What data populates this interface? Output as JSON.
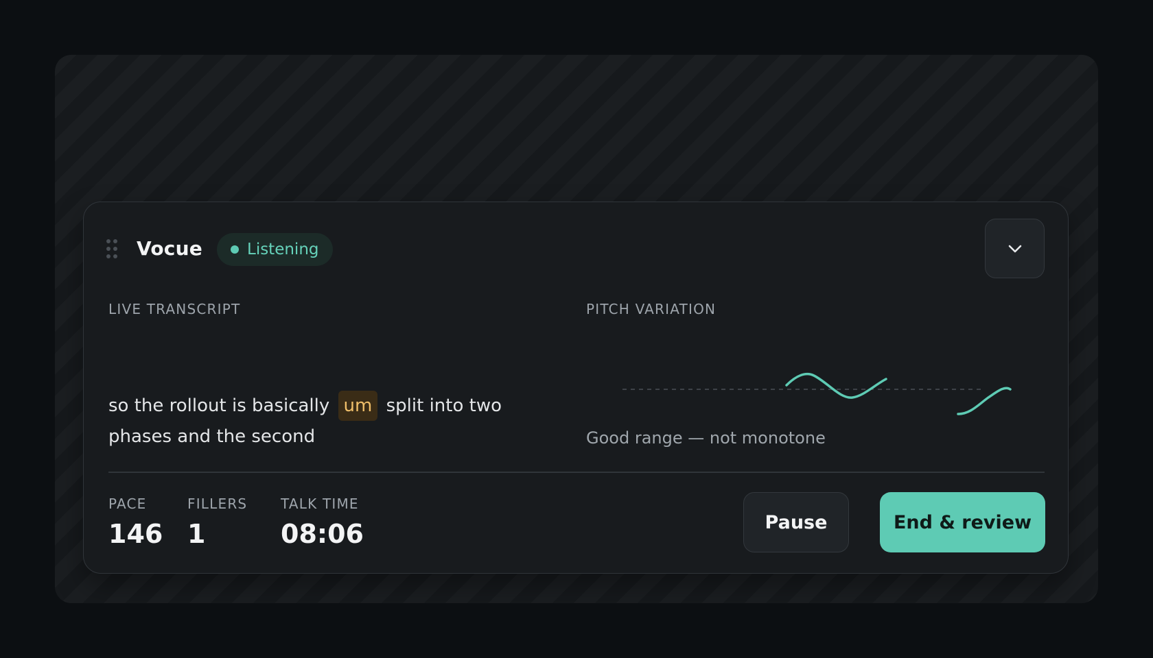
{
  "app": {
    "title": "Vocue",
    "status": "Listening"
  },
  "colors": {
    "accent": "#5ecbb4",
    "filler_highlight": "#f0bf6a",
    "background": "#0c0f12",
    "panel": "#181b1e"
  },
  "icons": {
    "drag": "drag-handle-icon",
    "collapse": "chevron-down-icon",
    "status": "status-dot-icon"
  },
  "transcript": {
    "label": "LIVE TRANSCRIPT",
    "before_filler": "so the rollout is basically",
    "filler": "um",
    "after_filler": "split into two phases and the second"
  },
  "pitch": {
    "label": "PITCH VARIATION",
    "caption": "Good range — not monotone"
  },
  "stats": {
    "pace": {
      "label": "PACE",
      "value": "146"
    },
    "fillers": {
      "label": "FILLERS",
      "value": "1"
    },
    "talk_time": {
      "label": "TALK TIME",
      "value": "08:06"
    }
  },
  "actions": {
    "pause_label": "Pause",
    "end_label": "End & review"
  }
}
